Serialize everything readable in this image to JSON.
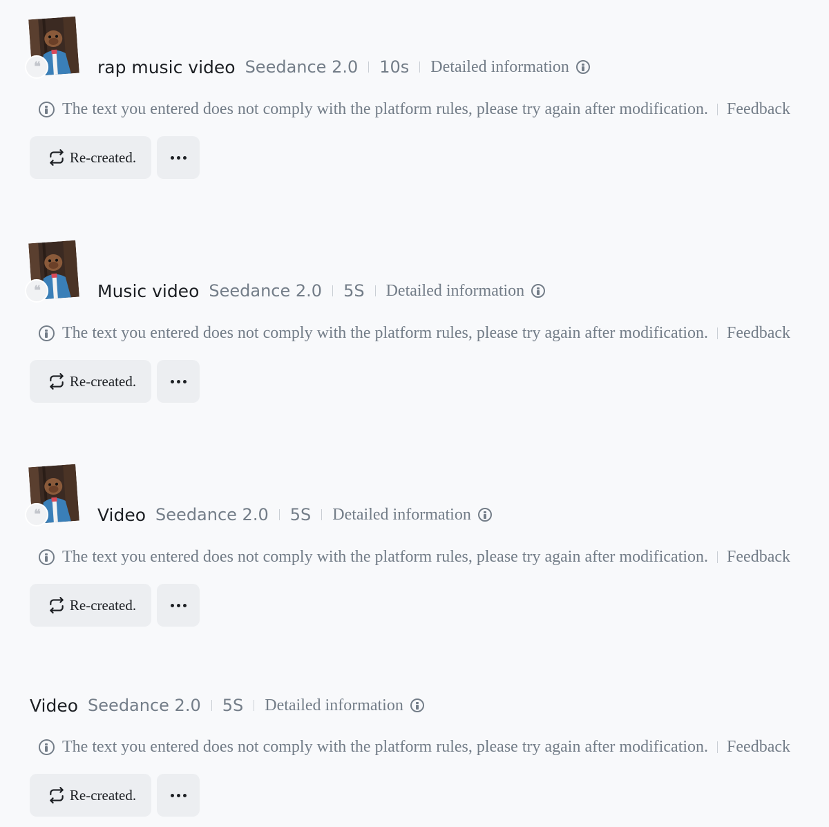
{
  "entries": [
    {
      "title": "rap music video",
      "model": "Seedance 2.0",
      "duration": "10s",
      "details_label": "Detailed information",
      "error_message": "The text you entered does not comply with the platform rules, please try again after modification.",
      "feedback_label": "Feedback",
      "recreate_label": "Re-created.",
      "has_thumbnail": true
    },
    {
      "title": "Music video",
      "model": "Seedance 2.0",
      "duration": "5S",
      "details_label": "Detailed information",
      "error_message": "The text you entered does not comply with the platform rules, please try again after modification.",
      "feedback_label": "Feedback",
      "recreate_label": "Re-created.",
      "has_thumbnail": true
    },
    {
      "title": "Video",
      "model": "Seedance 2.0",
      "duration": "5S",
      "details_label": "Detailed information",
      "error_message": "The text you entered does not comply with the platform rules, please try again after modification.",
      "feedback_label": "Feedback",
      "recreate_label": "Re-created.",
      "has_thumbnail": true
    },
    {
      "title": "Video",
      "model": "Seedance 2.0",
      "duration": "5S",
      "details_label": "Detailed information",
      "error_message": "The text you entered does not comply with the platform rules, please try again after modification.",
      "feedback_label": "Feedback",
      "recreate_label": "Re-created.",
      "has_thumbnail": false
    }
  ],
  "icons": {
    "quote": "quote-icon",
    "info": "info-icon",
    "recreate": "refresh-icon",
    "more": "more-horizontal-icon"
  },
  "colors": {
    "background": "#f8f9fb",
    "title": "#1c1f23",
    "muted": "#737d88",
    "button_bg": "#eceef1"
  }
}
